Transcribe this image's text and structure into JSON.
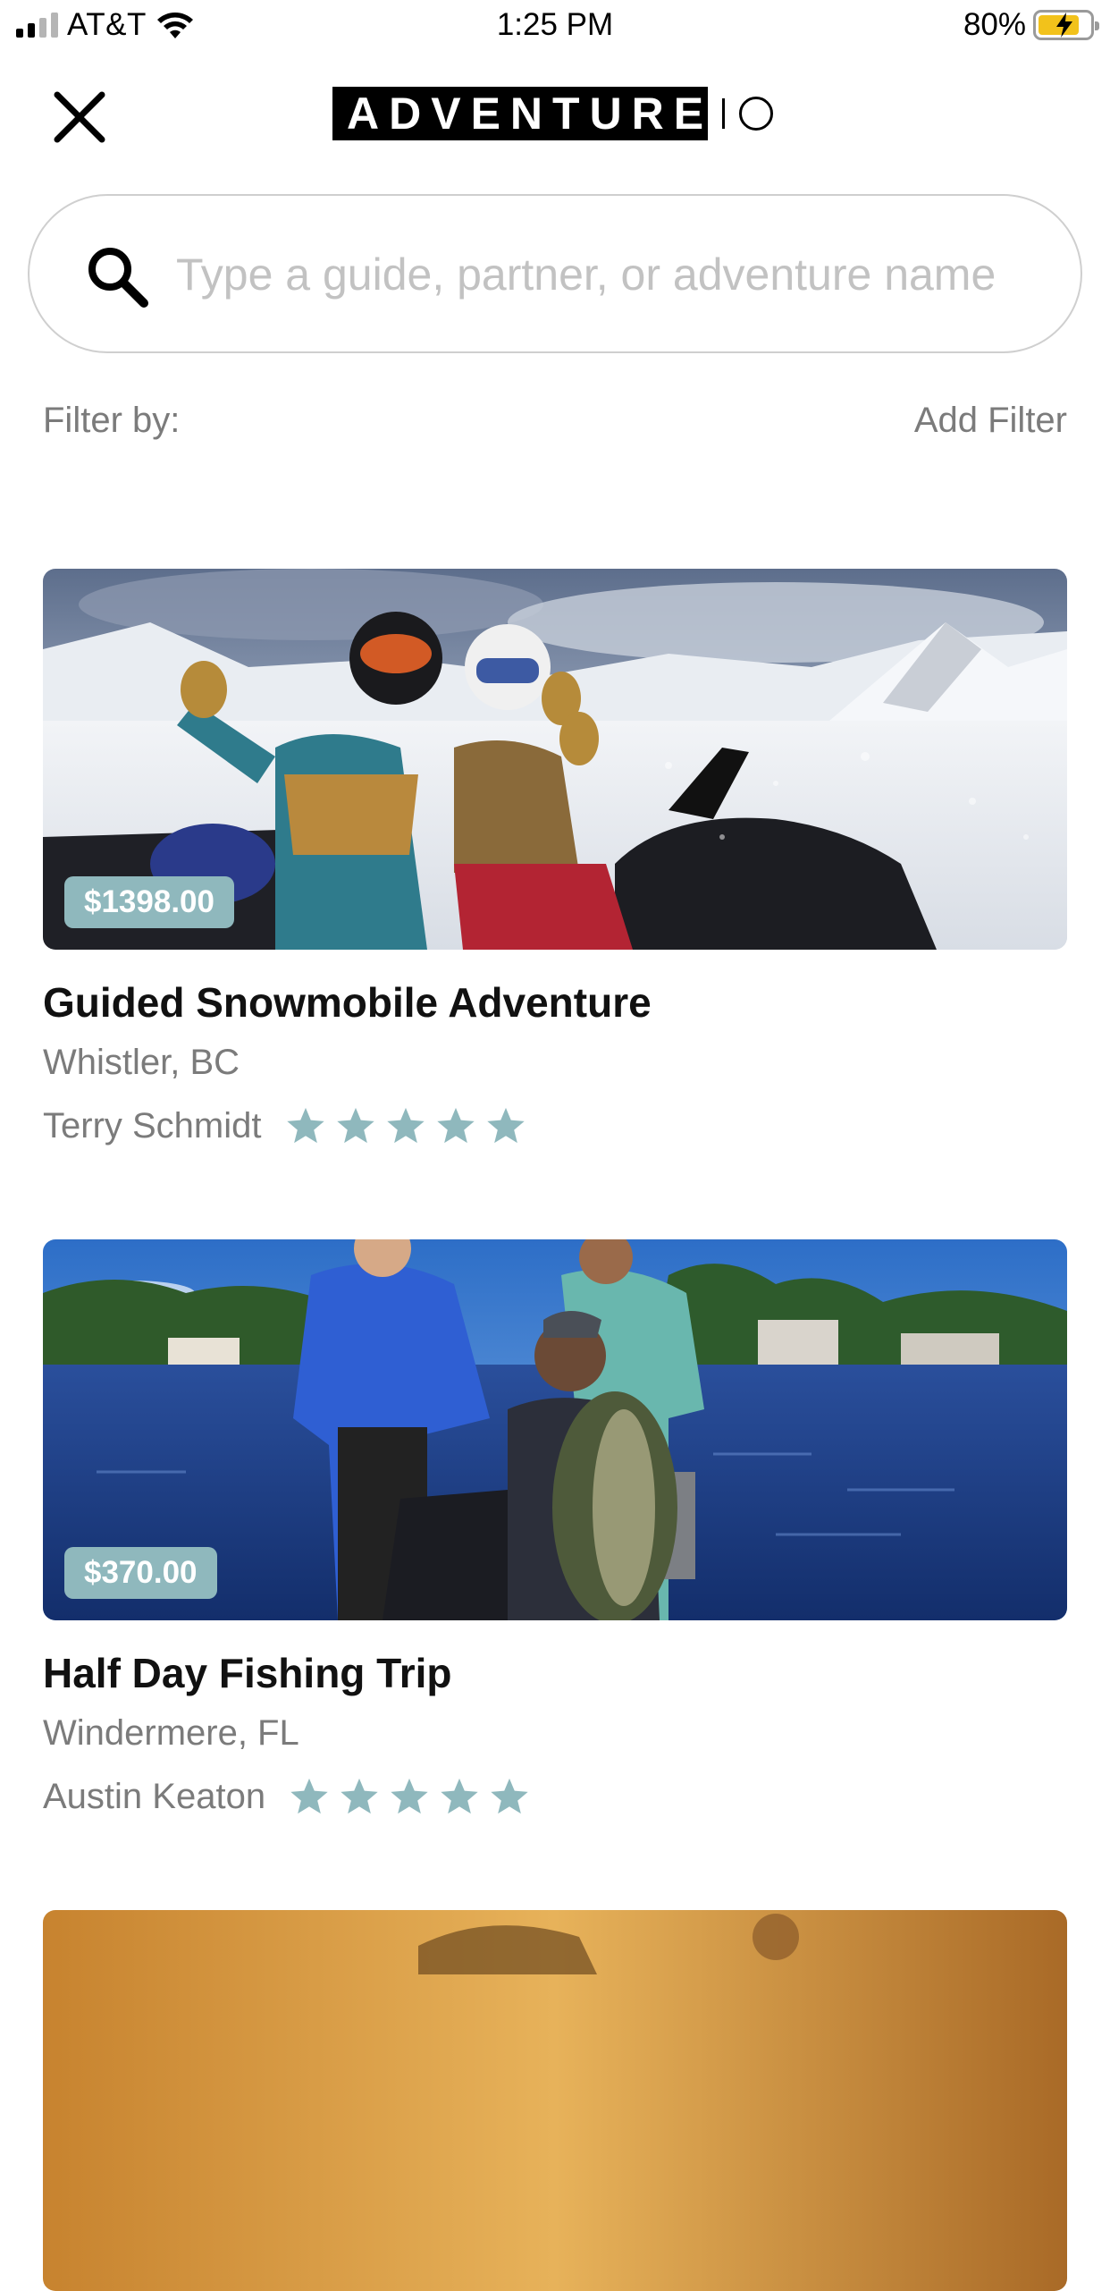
{
  "status_bar": {
    "carrier": "AT&T",
    "time": "1:25 PM",
    "battery_percent": "80%",
    "battery_level": 0.8,
    "icons": [
      "signal-icon",
      "wifi-icon",
      "battery-charging-icon"
    ]
  },
  "header": {
    "logo_text": "ADVENTURE",
    "close_icon": "close-icon"
  },
  "search": {
    "placeholder": "Type a guide, partner, or adventure name",
    "value": "",
    "icon": "search-icon"
  },
  "filter": {
    "label": "Filter by:",
    "add_label": "Add Filter"
  },
  "colors": {
    "accent": "#8fb8bd",
    "text_secondary": "#7b7b7b",
    "star": "#8fb8bd"
  },
  "adventures": [
    {
      "price": "$1398.00",
      "title": "Guided Snowmobile Adventure",
      "location": "Whistler, BC",
      "guide": "Terry Schmidt",
      "rating": 5
    },
    {
      "price": "$370.00",
      "title": "Half Day Fishing Trip",
      "location": "Windermere, FL",
      "guide": "Austin Keaton",
      "rating": 5
    }
  ]
}
